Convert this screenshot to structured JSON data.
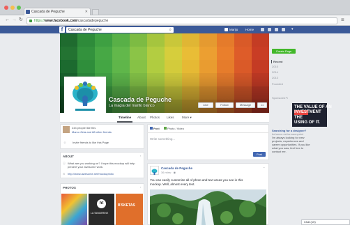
{
  "browser": {
    "tab_title": "Cascada de Peguche",
    "url_prefix": "https://",
    "url_host": "www.facebook.com",
    "url_path": "/cascadadepeguche",
    "back_icon": "back-arrow-icon",
    "forward_icon": "forward-arrow-icon",
    "reload_icon": "reload-icon",
    "menu_icon": "hamburger-icon",
    "traffic_colors": [
      "#ee5f5b",
      "#f6be4f",
      "#5fc454"
    ]
  },
  "fb_bar": {
    "search_value": "Cascada de Peguche",
    "user_name": "Marijo",
    "home_label": "Home",
    "brand_color": "#3b5998"
  },
  "cover": {
    "page_name": "Cascada de Peguche",
    "subtitle": "La magia del marllo blanco",
    "like_label": "Like",
    "follow_label": "Follow",
    "message_label": "Message",
    "more_label": "•••",
    "grid_colors": [
      [
        "#1f6b2f",
        "#2e8b3a",
        "#3ea042",
        "#58b047",
        "#7dbb43",
        "#a5c53e",
        "#c9c73a",
        "#e0b634",
        "#e59a30",
        "#e57b2b",
        "#d95a28",
        "#c43c24"
      ],
      [
        "#237332",
        "#33923d",
        "#47a845",
        "#62b84b",
        "#8bc447",
        "#b3cd41",
        "#d6ce3c",
        "#e9bd36",
        "#ec9f31",
        "#ea7f2c",
        "#de5c29",
        "#c93d25"
      ],
      [
        "#1c6a2f",
        "#2f8e3b",
        "#44a644",
        "#5fb64a",
        "#86c246",
        "#b0cc40",
        "#d3cb3b",
        "#e6b934",
        "#e99c30",
        "#e67c2b",
        "#da5a28",
        "#c43b24"
      ],
      [
        "#175f2b",
        "#2a8338",
        "#3e9c41",
        "#58ad47",
        "#7db944",
        "#a5c33f",
        "#c7c33a",
        "#dbb133",
        "#df942f",
        "#db752a",
        "#cf5527",
        "#b93723"
      ],
      [
        "#135526",
        "#247833",
        "#37903c",
        "#4fa143",
        "#72ad40",
        "#98b73b",
        "#b9b736",
        "#cda630",
        "#d18a2c",
        "#cd6c28",
        "#c24f25",
        "#ac3322"
      ],
      [
        "#0f4b22",
        "#1f6c2e",
        "#308437",
        "#47953e",
        "#679f3b",
        "#8ba936",
        "#aba932",
        "#bf9a2d",
        "#c3802a",
        "#bf6426",
        "#b44824",
        "#9f2f21"
      ]
    ]
  },
  "page_nav": {
    "tabs": [
      "Timeline",
      "About",
      "Photos",
      "Likes",
      "More ▾"
    ],
    "active": 0
  },
  "left_col": {
    "likes_text": "244 people like this",
    "likes_sub": "Marco Zeta and 88 other friends",
    "invite_text": "Invite friends to like this Page",
    "about_header": "ABOUT",
    "about_text1": "What are you working on? I hope this mockup will help",
    "about_text2": "present your awesome work.",
    "about_url": "http://www.awesome.net/mockupfolio",
    "photos_header": "PHOTOS",
    "photo_text2": "LA TANGERINE",
    "photo_text3": "B'SKETAS"
  },
  "composer": {
    "tab_post": "Post",
    "tab_photo": "Photo / Video",
    "placeholder": "Write something...",
    "post_button": "Post"
  },
  "post": {
    "author": "Cascada de Peguche",
    "time": "36 mins · ",
    "text1": "You can easily customize all of photo and text areas you see in this",
    "text2": "mockup. Well, almost every text."
  },
  "right_col": {
    "create_page": "Create Page",
    "years": [
      "Recent",
      "2015",
      "2014",
      "2013",
      "Founded"
    ],
    "sponsored": "Sponsored",
    "ad_line1": "THE VALUE OF AN",
    "ad_line2": "INVESTMENT",
    "ad_line3": "THE",
    "ad_line4": "USING OF IT.",
    "ad_title": "Searching for a designer?",
    "ad_sub": "behance.net/annaonpaint",
    "ad_body1": "I'm always looking for new",
    "ad_body2": "projects, experiences and",
    "ad_body3": "career opportunities. If you like",
    "ad_body4": "what you saw, feel free to",
    "ad_body5": "contact me.",
    "chat_label": "Chat (10)",
    "accent_color": "#42b72a"
  }
}
